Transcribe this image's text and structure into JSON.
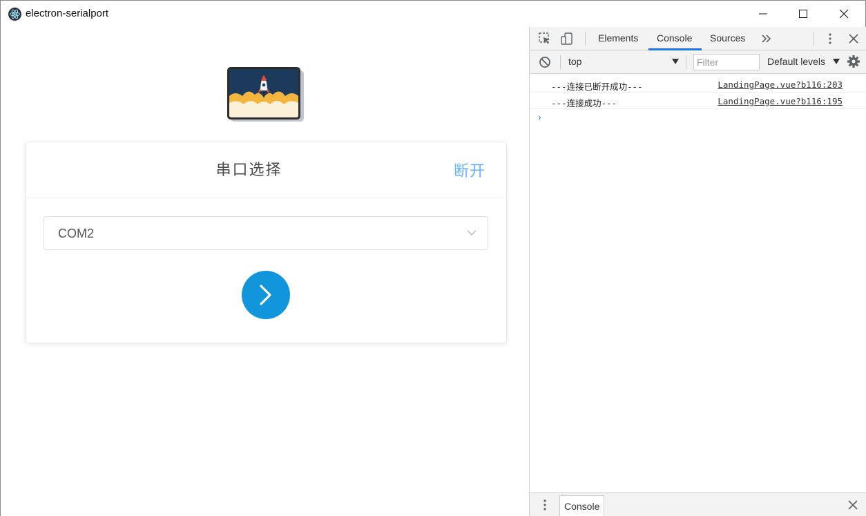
{
  "window": {
    "title": "electron-serialport",
    "icon": "electron-atom-icon",
    "controls": [
      "minimize-icon",
      "maximize-icon",
      "close-icon"
    ]
  },
  "app": {
    "logo": "rocket-launch-logo",
    "card": {
      "title": "串口选择",
      "action_label": "断开",
      "select": {
        "value": "COM2",
        "icon": "chevron-down-icon"
      },
      "go_button_icon": "chevron-right-icon"
    },
    "colors": {
      "accent": "#1296db",
      "link": "#66b1ff"
    }
  },
  "devtools": {
    "tabs": [
      {
        "label": "Elements",
        "active": false
      },
      {
        "label": "Console",
        "active": true
      },
      {
        "label": "Sources",
        "active": false
      }
    ],
    "toolbar": {
      "context": "top",
      "filter_placeholder": "Filter",
      "levels": "Default levels"
    },
    "logs": [
      {
        "message": "---连接已断开成功---",
        "source": "LandingPage.vue?b116:203"
      },
      {
        "message": "---连接成功---",
        "source": "LandingPage.vue?b116:195"
      }
    ],
    "prompt": "›",
    "drawer": {
      "tab": "Console"
    },
    "colors": {
      "active_tab": "#1a73e8"
    }
  }
}
